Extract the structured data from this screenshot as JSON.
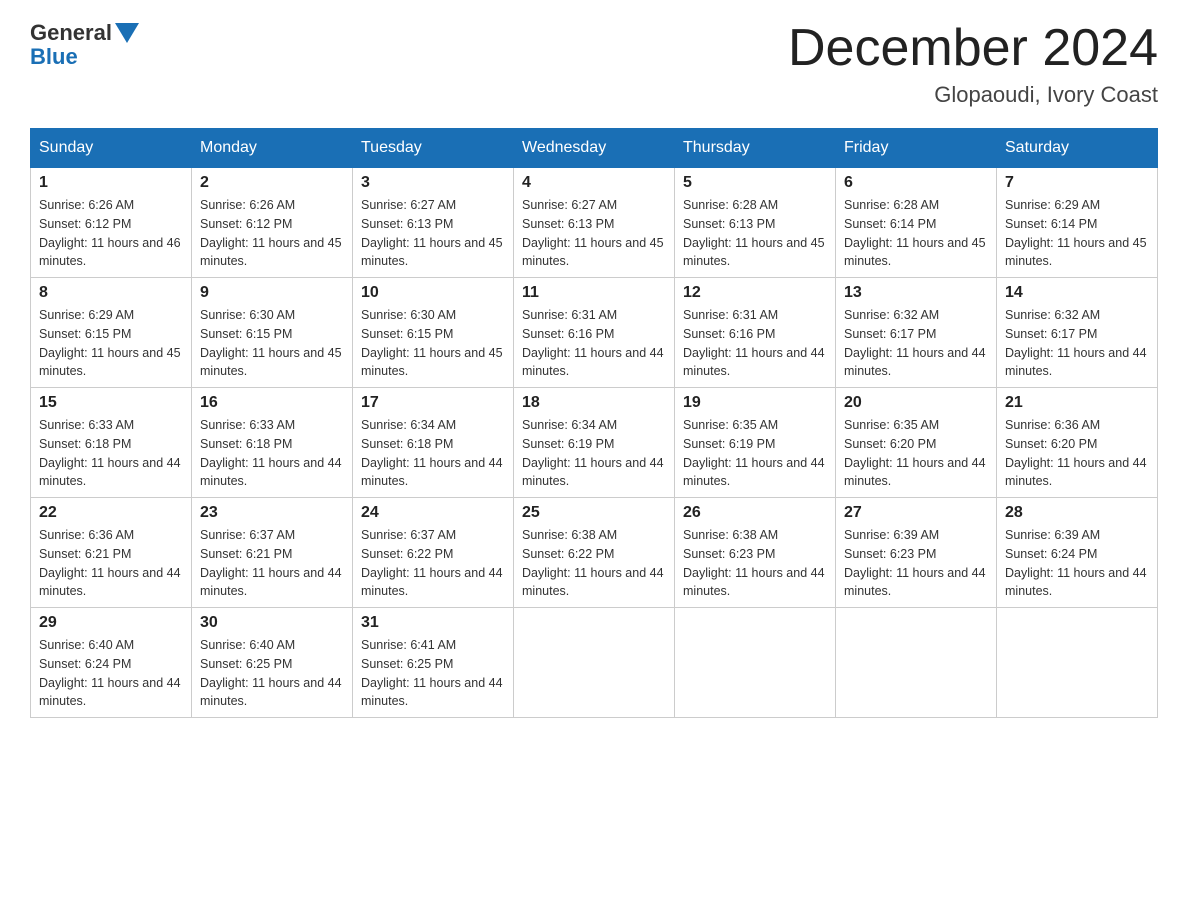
{
  "logo": {
    "general": "General",
    "blue": "Blue"
  },
  "title": "December 2024",
  "location": "Glopaoudi, Ivory Coast",
  "weekdays": [
    "Sunday",
    "Monday",
    "Tuesday",
    "Wednesday",
    "Thursday",
    "Friday",
    "Saturday"
  ],
  "weeks": [
    [
      {
        "day": "1",
        "sunrise": "6:26 AM",
        "sunset": "6:12 PM",
        "daylight": "11 hours and 46 minutes."
      },
      {
        "day": "2",
        "sunrise": "6:26 AM",
        "sunset": "6:12 PM",
        "daylight": "11 hours and 45 minutes."
      },
      {
        "day": "3",
        "sunrise": "6:27 AM",
        "sunset": "6:13 PM",
        "daylight": "11 hours and 45 minutes."
      },
      {
        "day": "4",
        "sunrise": "6:27 AM",
        "sunset": "6:13 PM",
        "daylight": "11 hours and 45 minutes."
      },
      {
        "day": "5",
        "sunrise": "6:28 AM",
        "sunset": "6:13 PM",
        "daylight": "11 hours and 45 minutes."
      },
      {
        "day": "6",
        "sunrise": "6:28 AM",
        "sunset": "6:14 PM",
        "daylight": "11 hours and 45 minutes."
      },
      {
        "day": "7",
        "sunrise": "6:29 AM",
        "sunset": "6:14 PM",
        "daylight": "11 hours and 45 minutes."
      }
    ],
    [
      {
        "day": "8",
        "sunrise": "6:29 AM",
        "sunset": "6:15 PM",
        "daylight": "11 hours and 45 minutes."
      },
      {
        "day": "9",
        "sunrise": "6:30 AM",
        "sunset": "6:15 PM",
        "daylight": "11 hours and 45 minutes."
      },
      {
        "day": "10",
        "sunrise": "6:30 AM",
        "sunset": "6:15 PM",
        "daylight": "11 hours and 45 minutes."
      },
      {
        "day": "11",
        "sunrise": "6:31 AM",
        "sunset": "6:16 PM",
        "daylight": "11 hours and 44 minutes."
      },
      {
        "day": "12",
        "sunrise": "6:31 AM",
        "sunset": "6:16 PM",
        "daylight": "11 hours and 44 minutes."
      },
      {
        "day": "13",
        "sunrise": "6:32 AM",
        "sunset": "6:17 PM",
        "daylight": "11 hours and 44 minutes."
      },
      {
        "day": "14",
        "sunrise": "6:32 AM",
        "sunset": "6:17 PM",
        "daylight": "11 hours and 44 minutes."
      }
    ],
    [
      {
        "day": "15",
        "sunrise": "6:33 AM",
        "sunset": "6:18 PM",
        "daylight": "11 hours and 44 minutes."
      },
      {
        "day": "16",
        "sunrise": "6:33 AM",
        "sunset": "6:18 PM",
        "daylight": "11 hours and 44 minutes."
      },
      {
        "day": "17",
        "sunrise": "6:34 AM",
        "sunset": "6:18 PM",
        "daylight": "11 hours and 44 minutes."
      },
      {
        "day": "18",
        "sunrise": "6:34 AM",
        "sunset": "6:19 PM",
        "daylight": "11 hours and 44 minutes."
      },
      {
        "day": "19",
        "sunrise": "6:35 AM",
        "sunset": "6:19 PM",
        "daylight": "11 hours and 44 minutes."
      },
      {
        "day": "20",
        "sunrise": "6:35 AM",
        "sunset": "6:20 PM",
        "daylight": "11 hours and 44 minutes."
      },
      {
        "day": "21",
        "sunrise": "6:36 AM",
        "sunset": "6:20 PM",
        "daylight": "11 hours and 44 minutes."
      }
    ],
    [
      {
        "day": "22",
        "sunrise": "6:36 AM",
        "sunset": "6:21 PM",
        "daylight": "11 hours and 44 minutes."
      },
      {
        "day": "23",
        "sunrise": "6:37 AM",
        "sunset": "6:21 PM",
        "daylight": "11 hours and 44 minutes."
      },
      {
        "day": "24",
        "sunrise": "6:37 AM",
        "sunset": "6:22 PM",
        "daylight": "11 hours and 44 minutes."
      },
      {
        "day": "25",
        "sunrise": "6:38 AM",
        "sunset": "6:22 PM",
        "daylight": "11 hours and 44 minutes."
      },
      {
        "day": "26",
        "sunrise": "6:38 AM",
        "sunset": "6:23 PM",
        "daylight": "11 hours and 44 minutes."
      },
      {
        "day": "27",
        "sunrise": "6:39 AM",
        "sunset": "6:23 PM",
        "daylight": "11 hours and 44 minutes."
      },
      {
        "day": "28",
        "sunrise": "6:39 AM",
        "sunset": "6:24 PM",
        "daylight": "11 hours and 44 minutes."
      }
    ],
    [
      {
        "day": "29",
        "sunrise": "6:40 AM",
        "sunset": "6:24 PM",
        "daylight": "11 hours and 44 minutes."
      },
      {
        "day": "30",
        "sunrise": "6:40 AM",
        "sunset": "6:25 PM",
        "daylight": "11 hours and 44 minutes."
      },
      {
        "day": "31",
        "sunrise": "6:41 AM",
        "sunset": "6:25 PM",
        "daylight": "11 hours and 44 minutes."
      },
      null,
      null,
      null,
      null
    ]
  ]
}
